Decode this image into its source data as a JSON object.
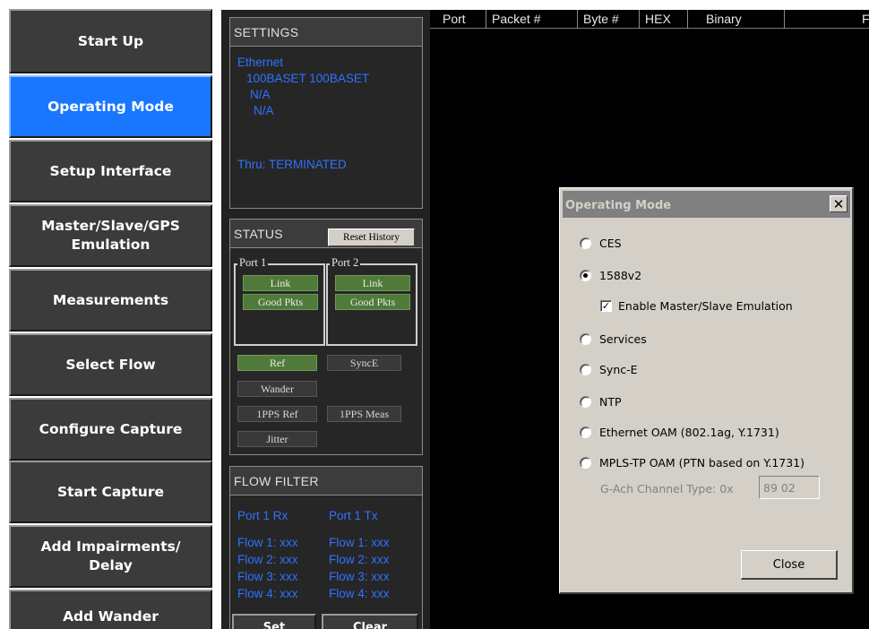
{
  "nav": {
    "items": [
      {
        "label": "Start Up"
      },
      {
        "label": "Operating Mode"
      },
      {
        "label": "Setup Interface"
      },
      {
        "label": "Master/Slave/GPS\nEmulation"
      },
      {
        "label": "Measurements"
      },
      {
        "label": "Select Flow"
      },
      {
        "label": "Configure Capture"
      },
      {
        "label": "Start Capture"
      },
      {
        "label": "Add Impairments/\nDelay"
      },
      {
        "label": "Add Wander"
      }
    ],
    "active_index": 1
  },
  "settings": {
    "title": "SETTINGS",
    "lines": [
      "Ethernet",
      "100BASET  100BASET",
      "N/A",
      "N/A",
      "Thru: TERMINATED"
    ]
  },
  "status": {
    "title": "STATUS",
    "reset_label": "Reset History",
    "port1": {
      "title": "Port 1",
      "link": "Link",
      "good": "Good Pkts"
    },
    "port2": {
      "title": "Port 2",
      "link": "Link",
      "good": "Good Pkts"
    },
    "indicators": {
      "ref": "Ref",
      "synce": "SyncE",
      "wander": "Wander",
      "pps_ref": "1PPS Ref",
      "pps_meas": "1PPS Meas",
      "jitter": "Jitter"
    }
  },
  "flow_filter": {
    "title": "FLOW FILTER",
    "rx_header": "Port 1 Rx",
    "tx_header": "Port 1 Tx",
    "rx": [
      "Flow 1: xxx",
      "Flow 2: xxx",
      "Flow 3: xxx",
      "Flow 4: xxx"
    ],
    "tx": [
      "Flow 1: xxx",
      "Flow 2: xxx",
      "Flow 3: xxx",
      "Flow 4: xxx"
    ],
    "buttons": [
      "Set",
      "Clear"
    ]
  },
  "capture_table": {
    "columns": [
      "Port",
      "Packet #",
      "Byte #",
      "HEX",
      "Binary",
      "F"
    ]
  },
  "dialog": {
    "title": "Operating Mode",
    "close_x": "x",
    "options": [
      {
        "label": "CES",
        "checked": false
      },
      {
        "label": "1588v2",
        "checked": true
      },
      {
        "label": "Services",
        "checked": false
      },
      {
        "label": "Sync-E",
        "checked": false
      },
      {
        "label": "NTP",
        "checked": false
      },
      {
        "label": "Ethernet OAM (802.1ag, Y.1731)",
        "checked": false
      },
      {
        "label": "MPLS-TP OAM (PTN based on Y.1731)",
        "checked": false
      }
    ],
    "enable_emulation": {
      "label": "Enable Master/Slave Emulation",
      "checked": true
    },
    "gach_label": "G-Ach Channel Type:  0x",
    "gach_value": "89 02",
    "close_button": "Close"
  },
  "colors": {
    "nav_bg": "#3b3b3b",
    "nav_active": "#1976ff",
    "status_text_blue": "#2f72ff",
    "indicator_on": "#507a3a",
    "dialog_bg": "#d4d0c8"
  }
}
